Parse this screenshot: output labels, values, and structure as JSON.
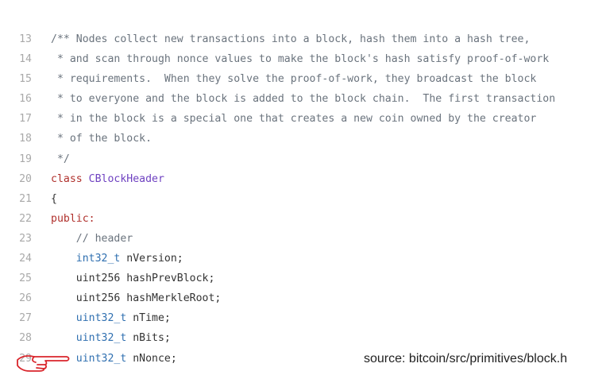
{
  "lines": [
    {
      "num": "13",
      "tokens": [
        {
          "t": "/** Nodes collect new transactions into a block, hash them into a hash tree,",
          "c": "comment"
        }
      ]
    },
    {
      "num": "14",
      "tokens": [
        {
          "t": " * and scan through nonce values to make the block's hash satisfy proof-of-work",
          "c": "comment"
        }
      ]
    },
    {
      "num": "15",
      "tokens": [
        {
          "t": " * requirements.  When they solve the proof-of-work, they broadcast the block",
          "c": "comment"
        }
      ]
    },
    {
      "num": "16",
      "tokens": [
        {
          "t": " * to everyone and the block is added to the block chain.  The first transaction",
          "c": "comment"
        }
      ]
    },
    {
      "num": "17",
      "tokens": [
        {
          "t": " * in the block is a special one that creates a new coin owned by the creator",
          "c": "comment"
        }
      ]
    },
    {
      "num": "18",
      "tokens": [
        {
          "t": " * of the block.",
          "c": "comment"
        }
      ]
    },
    {
      "num": "19",
      "tokens": [
        {
          "t": " */",
          "c": "comment"
        }
      ]
    },
    {
      "num": "20",
      "tokens": [
        {
          "t": "class",
          "c": "keyword"
        },
        {
          "t": " ",
          "c": "plain"
        },
        {
          "t": "CBlockHeader",
          "c": "class"
        }
      ]
    },
    {
      "num": "21",
      "tokens": [
        {
          "t": "{",
          "c": "plain"
        }
      ]
    },
    {
      "num": "22",
      "tokens": [
        {
          "t": "public:",
          "c": "keyword"
        }
      ]
    },
    {
      "num": "23",
      "tokens": [
        {
          "t": "    // header",
          "c": "comment"
        }
      ]
    },
    {
      "num": "24",
      "tokens": [
        {
          "t": "    ",
          "c": "plain"
        },
        {
          "t": "int32_t",
          "c": "type"
        },
        {
          "t": " nVersion;",
          "c": "plain"
        }
      ]
    },
    {
      "num": "25",
      "tokens": [
        {
          "t": "    uint256 hashPrevBlock;",
          "c": "plain"
        }
      ]
    },
    {
      "num": "26",
      "tokens": [
        {
          "t": "    uint256 hashMerkleRoot;",
          "c": "plain"
        }
      ]
    },
    {
      "num": "27",
      "tokens": [
        {
          "t": "    ",
          "c": "plain"
        },
        {
          "t": "uint32_t",
          "c": "type"
        },
        {
          "t": " nTime;",
          "c": "plain"
        }
      ]
    },
    {
      "num": "28",
      "tokens": [
        {
          "t": "    ",
          "c": "plain"
        },
        {
          "t": "uint32_t",
          "c": "type"
        },
        {
          "t": " nBits;",
          "c": "plain"
        }
      ]
    },
    {
      "num": "29",
      "tokens": [
        {
          "t": "    ",
          "c": "plain"
        },
        {
          "t": "uint32_t",
          "c": "type"
        },
        {
          "t": " nNonce;",
          "c": "plain"
        }
      ]
    }
  ],
  "caption": "source: bitcoin/src/primitives/block.h",
  "colors": {
    "comment": "#6a737d",
    "keyword": "#b0312d",
    "class": "#6f42c1",
    "type": "#2f6fb0",
    "plain": "#333333",
    "line_number": "#a9a9a9",
    "pointer": "#d9262c"
  },
  "pointer_icon": "pointing-hand-icon"
}
